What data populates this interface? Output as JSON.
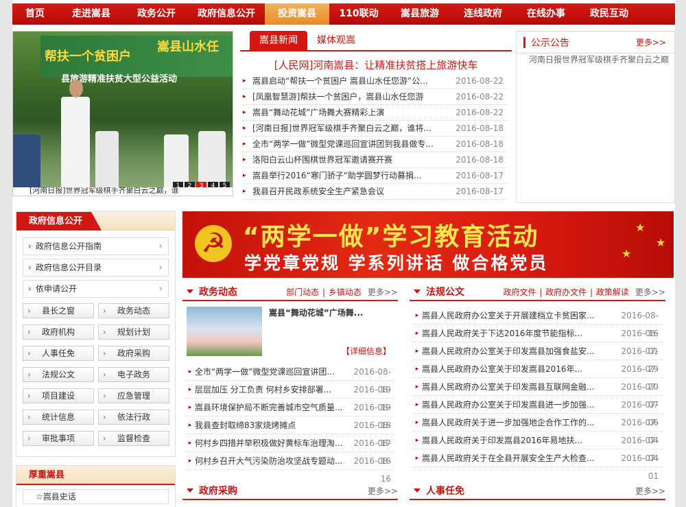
{
  "nav": [
    "首页",
    "走进嵩县",
    "政务公开",
    "政府信息公开",
    "投资嵩县",
    "110联动",
    "嵩县旅游",
    "连线政府",
    "在线办事",
    "政民互动"
  ],
  "nav_active_index": 4,
  "slider": {
    "banner_left": "帮扶一个贫困户",
    "banner_right": "嵩县山水任",
    "banner_sub": "县旅游精准扶贫大型公益活动",
    "dots": [
      "1",
      "2",
      "3",
      "4",
      "5"
    ],
    "active_dot": 3,
    "caption": "[河南日报]世界冠军级棋手齐聚白云之巅，谁"
  },
  "news": {
    "tab_active": "嵩县新闻",
    "tab_other": "媒体观嵩",
    "headline": "[人民网]河南嵩县：让精准扶贫搭上旅游快车",
    "items": [
      {
        "title": "嵩县启动“帮扶一个贫困户 嵩县山水任您游”公...",
        "date": "2016-08-22"
      },
      {
        "title": "[凤凰智慧游]帮扶一个贫困户，嵩县山水任您游",
        "date": "2016-08-22"
      },
      {
        "title": "嵩县“舞动花城”广场舞大赛精彩上演",
        "date": "2016-08-22"
      },
      {
        "title": "[河南日报]世界冠军级棋手齐聚白云之巅，谁将...",
        "date": "2016-08-18"
      },
      {
        "title": "全市“两学一做”微型党课巡回宣讲团到我县做专...",
        "date": "2016-08-18"
      },
      {
        "title": "洛阳白云山杯围棋世界冠军邀请赛开赛",
        "date": "2016-08-18"
      },
      {
        "title": "嵩县举行2016“寒门骄子”助学圆梦行动募捐...",
        "date": "2016-08-17"
      },
      {
        "title": "我县召开民政系统安全生产紧急会议",
        "date": "2016-08-17"
      }
    ]
  },
  "notice": {
    "title": "公示公告",
    "more": "更多>>",
    "text": "河南日报世界冠军级棋手齐聚白云之巅"
  },
  "gov_info": {
    "title": "政府信息公开",
    "guides": [
      "政府信息公开指南",
      "政府信息公开目录",
      "依申请公开"
    ],
    "buttons": [
      "县长之窗",
      "政务动态",
      "政府机构",
      "规划计划",
      "人事任免",
      "政府采购",
      "法规公文",
      "电子政务",
      "项目建设",
      "应急管理",
      "统计信息",
      "依法行政",
      "审批事项",
      "监督检查"
    ]
  },
  "hz": {
    "title": "厚重嵩县",
    "item": "☆嵩县史话"
  },
  "banner": {
    "line1": "“两学一做”学习教育活动",
    "line2": "学党章党规  学系列讲话  做合格党员"
  },
  "zwdt": {
    "title": "政务动态",
    "subs": [
      "部门动态",
      "乡镇动态"
    ],
    "more": "更多>>",
    "feature_title": "嵩县“舞动花城”广场舞...",
    "feature_more": "【详细信息】",
    "items": [
      {
        "title": "全市“两学一做”微型党课巡回宣讲团...",
        "date": "2016-08-19"
      },
      {
        "title": "层层加压 分工负责 何村乡安排部署...",
        "date": "2016-08-19"
      },
      {
        "title": "嵩县环境保护局不断完善城市空气质量...",
        "date": "2016-08-18"
      },
      {
        "title": "我县查封取缔83家烧烤摊点",
        "date": "2016-08-17"
      },
      {
        "title": "何村乡四措并举积极做好黄标车治理淘...",
        "date": "2016-08-16"
      },
      {
        "title": "何村乡召开大气污染防治攻坚战专题动...",
        "date": "2016-08-16"
      }
    ]
  },
  "fggw": {
    "title": "法规公文",
    "subs": [
      "政府文件",
      "政府办文件",
      "政策解读"
    ],
    "more": "更多>>",
    "items": [
      {
        "title": "嵩县人民政府办公室关于开展建档立卡贫困家...",
        "date": "2016-08-16"
      },
      {
        "title": "嵩县人民政府关于下达2016年度节能指标...",
        "date": "2016-08-01"
      },
      {
        "title": "嵩县人民政府办公室关于印发嵩县加强食盐安...",
        "date": "2016-07-29"
      },
      {
        "title": "嵩县人民政府办公室关于印发嵩县2016年...",
        "date": "2016-07-20"
      },
      {
        "title": "嵩县人民政府办公室关于印发嵩县互联网金融...",
        "date": "2016-07-07"
      },
      {
        "title": "嵩县人民政府办公室关于印发嵩县进一步加强...",
        "date": "2016-07-06"
      },
      {
        "title": "嵩县人民政府关于进一步加强地企合作工作的...",
        "date": "2016-07-04"
      },
      {
        "title": "嵩县人民政府关于印发嵩县2016年易地扶...",
        "date": "2016-07-04"
      },
      {
        "title": "嵩县人民政府关于在全县开展安全生产大检查...",
        "date": "2016-07-01"
      }
    ]
  },
  "zfcg": {
    "title": "政府采购",
    "more": "更多>>"
  },
  "rsrm": {
    "title": "人事任免",
    "more": "更多>>"
  }
}
